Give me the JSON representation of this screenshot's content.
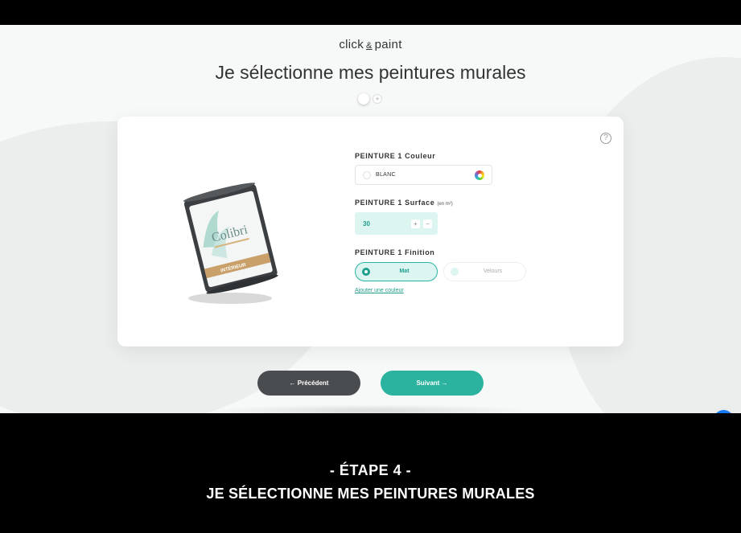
{
  "header": {
    "logo_left": "click",
    "logo_amp": "&",
    "logo_right": "paint",
    "title": "Je sélectionne mes peintures murales",
    "step_add": "+"
  },
  "product": {
    "brand": "Colibri",
    "range": "INTÉRIEUR"
  },
  "form": {
    "color": {
      "label": "PEINTURE 1 Couleur",
      "value": "BLANC"
    },
    "surface": {
      "label": "PEINTURE 1 Surface",
      "unit": "(en m²)",
      "value": "30",
      "plus": "+",
      "minus": "−"
    },
    "finish": {
      "label": "PEINTURE 1 Finition",
      "options": [
        "Mat",
        "Velours"
      ],
      "selected": "Mat"
    },
    "add_color_link": "Ajouter une couleur",
    "help": "?"
  },
  "nav": {
    "prev_label": "← Précédent",
    "next_label": "Suivant →"
  },
  "caption": {
    "step": "- ÉTAPE 4 -",
    "title": "JE SÉLECTIONNE MES PEINTURES MURALES"
  },
  "colors": {
    "accent": "#2bb3a0",
    "accent_light": "#dcf5f1",
    "dark_button": "#4a4d50",
    "messenger": "#1877f2"
  }
}
